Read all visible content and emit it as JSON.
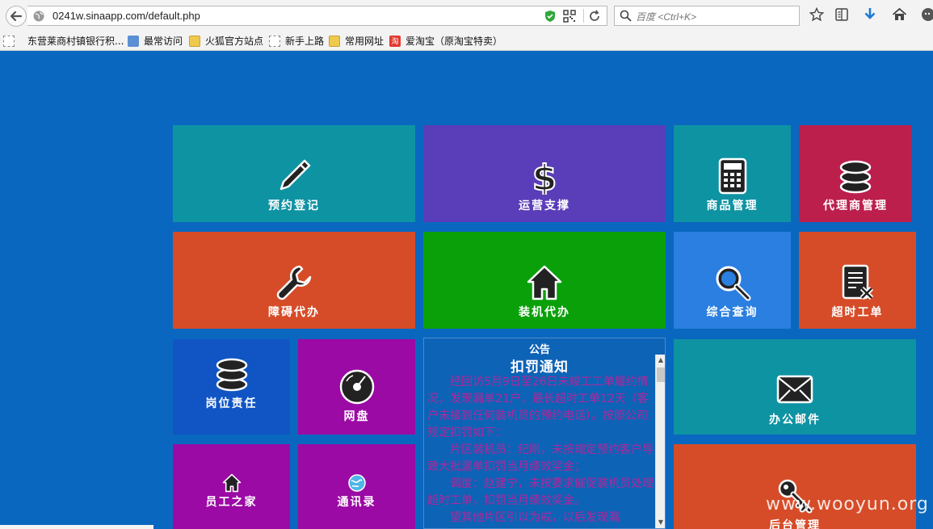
{
  "browser": {
    "url": "0241w.sinaapp.com/default.php",
    "search_placeholder": "百度 <Ctrl+K>"
  },
  "bookmarks": [
    {
      "label": "东营莱商村镇银行积...",
      "icon": "page-icon"
    },
    {
      "label": "最常访问",
      "icon": "search-page-icon"
    },
    {
      "label": "火狐官方站点",
      "icon": "folder-icon"
    },
    {
      "label": "新手上路",
      "icon": "page-icon"
    },
    {
      "label": "常用网址",
      "icon": "folder-icon"
    },
    {
      "label": "爱淘宝（原淘宝特卖）",
      "icon": "taobao-icon"
    }
  ],
  "tiles": {
    "booking": "预约登记",
    "operations": "运营支撑",
    "products": "商品管理",
    "agents": "代理商管理",
    "fault": "障碍代办",
    "install": "装机代办",
    "query": "综合查询",
    "overtime": "超时工单",
    "duties": "岗位责任",
    "netdisk": "网盘",
    "mail": "办公邮件",
    "staff": "员工之家",
    "contacts": "通讯录",
    "admin": "后台管理"
  },
  "notice": {
    "heading": "公告",
    "title": "扣罚通知",
    "paragraphs": [
      "经回访5月9日至26日未竣工工单履约情况，发现漏单21户，最长超时工单12天（客户未接到任何装机员的预约电话）。按照公司规定扣罚如下：",
      "片区装机员：纪刚，未按规定预约客户导致大批漏单扣罚当月绩效奖金；",
      "调度：赵建宁，未按要求催促装机员处理超时工单，扣罚当月绩效奖金。",
      "望其他片区引以为戒，以后发现漏"
    ]
  },
  "watermark": "www.wooyun.org",
  "colors": {
    "page_bg": "#0a67bf",
    "teal": "#0e93a3",
    "purple": "#5a3db8",
    "crimson": "#bd1f4d",
    "orange": "#d64c28",
    "green": "#0aa00a",
    "blue": "#2b7fe0",
    "royal": "#1155c4",
    "magenta": "#9b0aa4",
    "notice_text": "#b1279b"
  }
}
